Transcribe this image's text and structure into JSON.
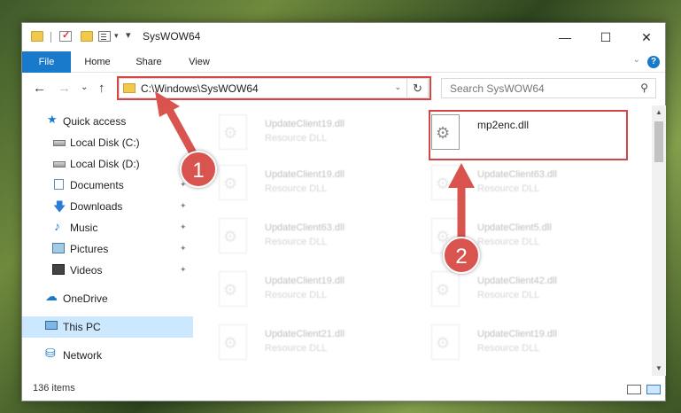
{
  "window": {
    "title": "SysWOW64",
    "controls": {
      "minimize": "—",
      "maximize": "☐",
      "close": "✕"
    }
  },
  "ribbon": {
    "tabs": [
      "File",
      "Home",
      "Share",
      "View"
    ],
    "chevron": "⌄",
    "help": "?"
  },
  "nav": {
    "back": "←",
    "forward": "→",
    "recent": "⌄",
    "up": "↑",
    "address": "C:\\Windows\\SysWOW64",
    "dropdown": "⌄",
    "refresh": "↻",
    "search_placeholder": "Search SysWOW64",
    "search_glyph": "⚲"
  },
  "sidebar": {
    "items": [
      {
        "label": "Quick access",
        "icon": "star-icon"
      },
      {
        "label": "Local Disk (C:)",
        "icon": "drive-icon"
      },
      {
        "label": "Local Disk (D:)",
        "icon": "drive-icon"
      },
      {
        "label": "Documents",
        "icon": "documents-icon",
        "pinned": true
      },
      {
        "label": "Downloads",
        "icon": "download-icon",
        "pinned": true
      },
      {
        "label": "Music",
        "icon": "music-icon",
        "pinned": true
      },
      {
        "label": "Pictures",
        "icon": "pictures-icon",
        "pinned": true
      },
      {
        "label": "Videos",
        "icon": "videos-icon",
        "pinned": true
      },
      {
        "label": "OneDrive",
        "icon": "cloud-icon"
      },
      {
        "label": "This PC",
        "icon": "pc-icon",
        "selected": true
      },
      {
        "label": "Network",
        "icon": "network-icon"
      }
    ],
    "pin_glyph": "📌"
  },
  "files": [
    {
      "name": "UpdateClient19.dll",
      "type": "Resource DLL"
    },
    {
      "name": "mp2enc.dll",
      "type": ""
    },
    {
      "name": "UpdateClient19.dll",
      "type": "Resource DLL"
    },
    {
      "name": "UpdateClient63.dll",
      "type": "Resource DLL"
    },
    {
      "name": "UpdateClient63.dll",
      "type": "Resource DLL"
    },
    {
      "name": "UpdateClient5.dll",
      "type": "Resource DLL"
    },
    {
      "name": "UpdateClient19.dll",
      "type": "Resource DLL"
    },
    {
      "name": "UpdateClient42.dll",
      "type": "Resource DLL"
    },
    {
      "name": "UpdateClient21.dll",
      "type": "Resource DLL"
    },
    {
      "name": "UpdateClient19.dll",
      "type": "Resource DLL"
    }
  ],
  "status": {
    "item_count": "136 items"
  },
  "annotations": {
    "badge1": "1",
    "badge2": "2",
    "color": "#d9534f"
  }
}
